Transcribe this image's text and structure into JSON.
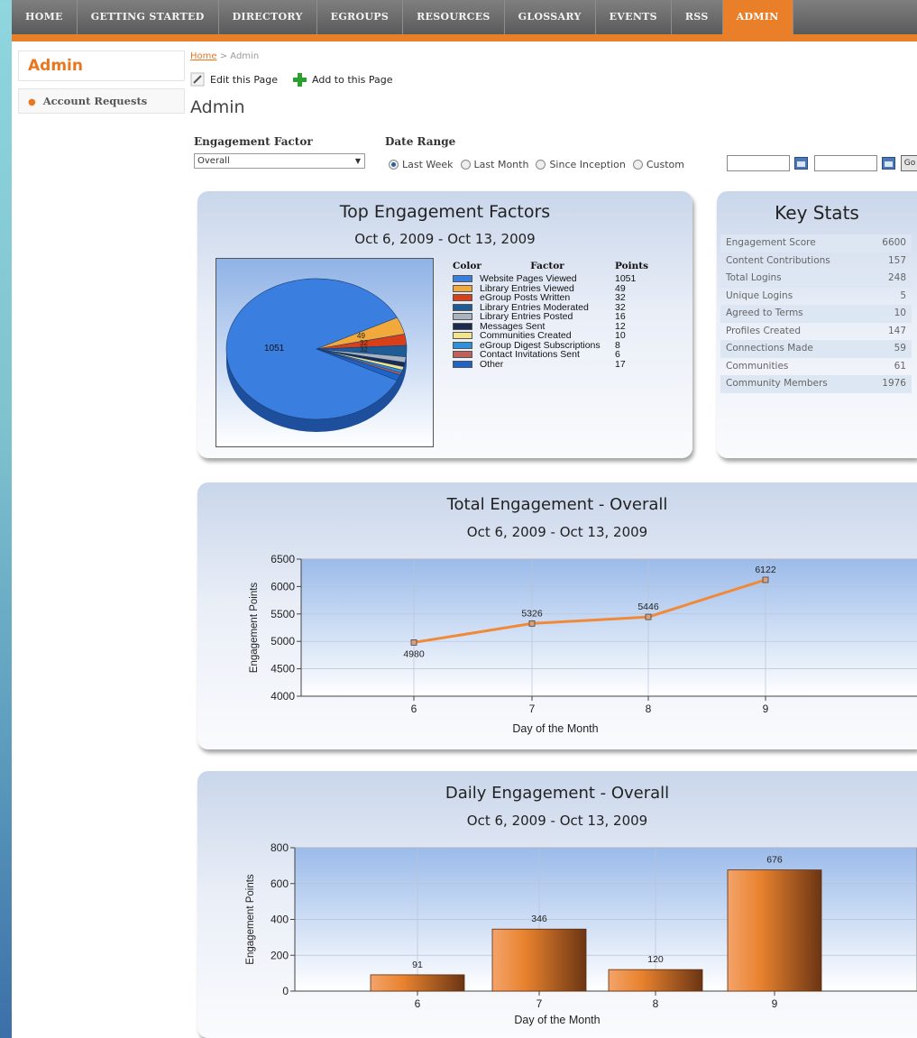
{
  "nav": {
    "items": [
      {
        "label": "HOME",
        "active": false
      },
      {
        "label": "GETTING STARTED",
        "active": false
      },
      {
        "label": "DIRECTORY",
        "active": false
      },
      {
        "label": "EGROUPS",
        "active": false
      },
      {
        "label": "RESOURCES",
        "active": false
      },
      {
        "label": "GLOSSARY",
        "active": false
      },
      {
        "label": "EVENTS",
        "active": false
      },
      {
        "label": "RSS",
        "active": false
      },
      {
        "label": "ADMIN",
        "active": true
      }
    ]
  },
  "sidebar": {
    "title": "Admin",
    "items": [
      {
        "label": "Account Requests"
      }
    ]
  },
  "breadcrumb": {
    "home": "Home",
    "sep": " > ",
    "current": "Admin"
  },
  "toolbar": {
    "edit_label": "Edit this Page",
    "add_label": "Add to this Page"
  },
  "page_title": "Admin",
  "filters": {
    "engagement_label": "Engagement Factor",
    "engagement_value": "Overall",
    "date_range_label": "Date Range",
    "options": [
      {
        "label": "Last Week",
        "selected": true
      },
      {
        "label": "Last Month",
        "selected": false
      },
      {
        "label": "Since Inception",
        "selected": false
      },
      {
        "label": "Custom",
        "selected": false
      }
    ],
    "go_label": "Go"
  },
  "colors": {
    "accent": "#ea7f2a",
    "nav_bg": "#5a5a5a"
  },
  "top_factors": {
    "title": "Top Engagement Factors",
    "subtitle": "Oct 6, 2009 - Oct 13, 2009",
    "legend_headers": {
      "color": "Color",
      "factor": "Factor",
      "points": "Points"
    }
  },
  "key_stats": {
    "title": "Key Stats",
    "rows": [
      {
        "label": "Engagement Score",
        "value": "6600"
      },
      {
        "label": "Content Contributions",
        "value": "157"
      },
      {
        "label": "Total Logins",
        "value": "248"
      },
      {
        "label": "Unique Logins",
        "value": "5"
      },
      {
        "label": "Agreed to Terms",
        "value": "10"
      },
      {
        "label": "Profiles Created",
        "value": "147"
      },
      {
        "label": "Connections Made",
        "value": "59"
      },
      {
        "label": "Communities",
        "value": "61"
      },
      {
        "label": "Community Members",
        "value": "1976"
      }
    ]
  },
  "total_panel": {
    "title": "Total Engagement - Overall",
    "subtitle": "Oct 6, 2009 - Oct 13, 2009"
  },
  "daily_panel": {
    "title": "Daily Engagement - Overall",
    "subtitle": "Oct 6, 2009 - Oct 13, 2009"
  },
  "chart_data": [
    {
      "type": "pie",
      "title": "Top Engagement Factors",
      "categories": [
        "Website Pages Viewed",
        "Library Entries Viewed",
        "eGroup Posts Written",
        "Library Entries Moderated",
        "Library Entries Posted",
        "Messages Sent",
        "Communities Created",
        "eGroup Digest Subscriptions",
        "Contact Invitations Sent",
        "Other"
      ],
      "values": [
        1051,
        49,
        32,
        32,
        16,
        12,
        10,
        8,
        6,
        17
      ],
      "colors": [
        "#3a7fe0",
        "#f2a93b",
        "#d9401a",
        "#1f5b94",
        "#a9b3bd",
        "#1d2a4f",
        "#f3e38a",
        "#2f8fd8",
        "#c0605a",
        "#1e63c8"
      ],
      "visible_labels": [
        1051,
        49,
        32
      ]
    },
    {
      "type": "line",
      "title": "Total Engagement - Overall",
      "x": [
        6,
        7,
        8,
        9
      ],
      "values": [
        4980,
        5326,
        5446,
        6122
      ],
      "xlabel": "Day of the Month",
      "ylabel": "Engagement Points",
      "ylim": [
        4000,
        6500
      ],
      "yticks": [
        4000,
        4500,
        5000,
        5500,
        6000,
        6500
      ],
      "grid": true,
      "color": "#f08a3a"
    },
    {
      "type": "bar",
      "title": "Daily Engagement - Overall",
      "categories": [
        "6",
        "7",
        "8",
        "9"
      ],
      "values": [
        91,
        346,
        120,
        676
      ],
      "xlabel": "Day of the Month",
      "ylabel": "Engagement Points",
      "ylim": [
        0,
        800
      ],
      "yticks": [
        0,
        200,
        400,
        600,
        800
      ],
      "grid": true,
      "color": "#e8822e"
    }
  ]
}
